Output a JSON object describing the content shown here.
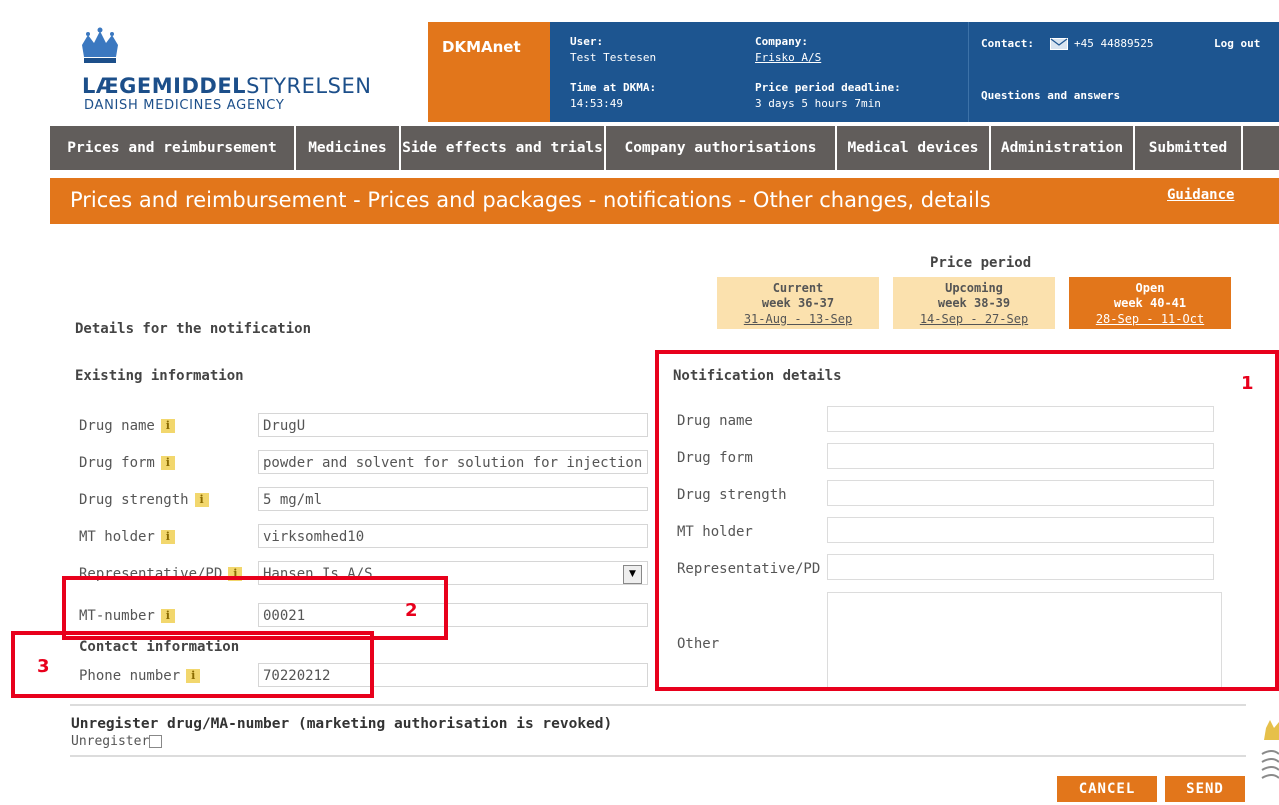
{
  "header": {
    "logo_main_bold": "LÆGEMIDDEL",
    "logo_main_rest": "STYRELSEN",
    "logo_sub": "DANISH MEDICINES AGENCY",
    "app_name": "DKMAnet",
    "user_label": "User:",
    "user_value": "Test Testesen",
    "time_label": "Time at DKMA:",
    "time_value": "14:53:49",
    "company_label": "Company:",
    "company_value": "Frisko A/S",
    "deadline_label": "Price period deadline:",
    "deadline_value": "3 days 5 hours 7min",
    "contact_label": "Contact:",
    "contact_phone": "+45 44889525",
    "logout": "Log out",
    "qa": "Questions and answers"
  },
  "nav": [
    {
      "label": "Prices and reimbursement"
    },
    {
      "label": "Medicines"
    },
    {
      "label": "Side effects and trials"
    },
    {
      "label": "Company authorisations"
    },
    {
      "label": "Medical devices"
    },
    {
      "label": "Administration"
    },
    {
      "label": "Submitted"
    }
  ],
  "title": "Prices and reimbursement - Prices and packages - notifications - Other changes, details",
  "guidance": "Guidance",
  "price_period": {
    "title": "Price period",
    "boxes": [
      {
        "l1": "Current",
        "l2": "week 36-37",
        "l3": "31-Aug - 13-Sep"
      },
      {
        "l1": "Upcoming",
        "l2": "week 38-39",
        "l3": "14-Sep - 27-Sep"
      },
      {
        "l1": "Open",
        "l2": "week 40-41",
        "l3": "28-Sep - 11-Oct"
      }
    ]
  },
  "form": {
    "details_title": "Details for the notification",
    "existing_title": "Existing information",
    "existing": [
      {
        "label": "Drug name",
        "value": "DrugU"
      },
      {
        "label": "Drug form",
        "value": "powder and solvent for solution for injection"
      },
      {
        "label": "Drug strength",
        "value": "5 mg/ml"
      },
      {
        "label": "MT holder",
        "value": "virksomhed10"
      },
      {
        "label": "Representative/PD",
        "value": "Hansen Is A/S"
      },
      {
        "label": "MT-number",
        "value": "00021"
      }
    ],
    "info_icon": "i",
    "contact_title": "Contact information",
    "phone_label": "Phone number",
    "phone_value": "70220212",
    "notification_title": "Notification details",
    "notification_labels": [
      "Drug name",
      "Drug form",
      "Drug strength",
      "MT holder",
      "Representative/PD",
      "Other"
    ],
    "unregister_title": "Unregister drug/MA-number (marketing authorisation is revoked)",
    "unregister_label": "Unregister",
    "cancel": "CANCEL",
    "send": "SEND"
  },
  "annotations": {
    "n1": "1",
    "n2": "2",
    "n3": "3"
  },
  "colors": {
    "orange": "#e2761b",
    "blue": "#1d5590",
    "nav": "#615d5b",
    "red": "#e8001c"
  }
}
